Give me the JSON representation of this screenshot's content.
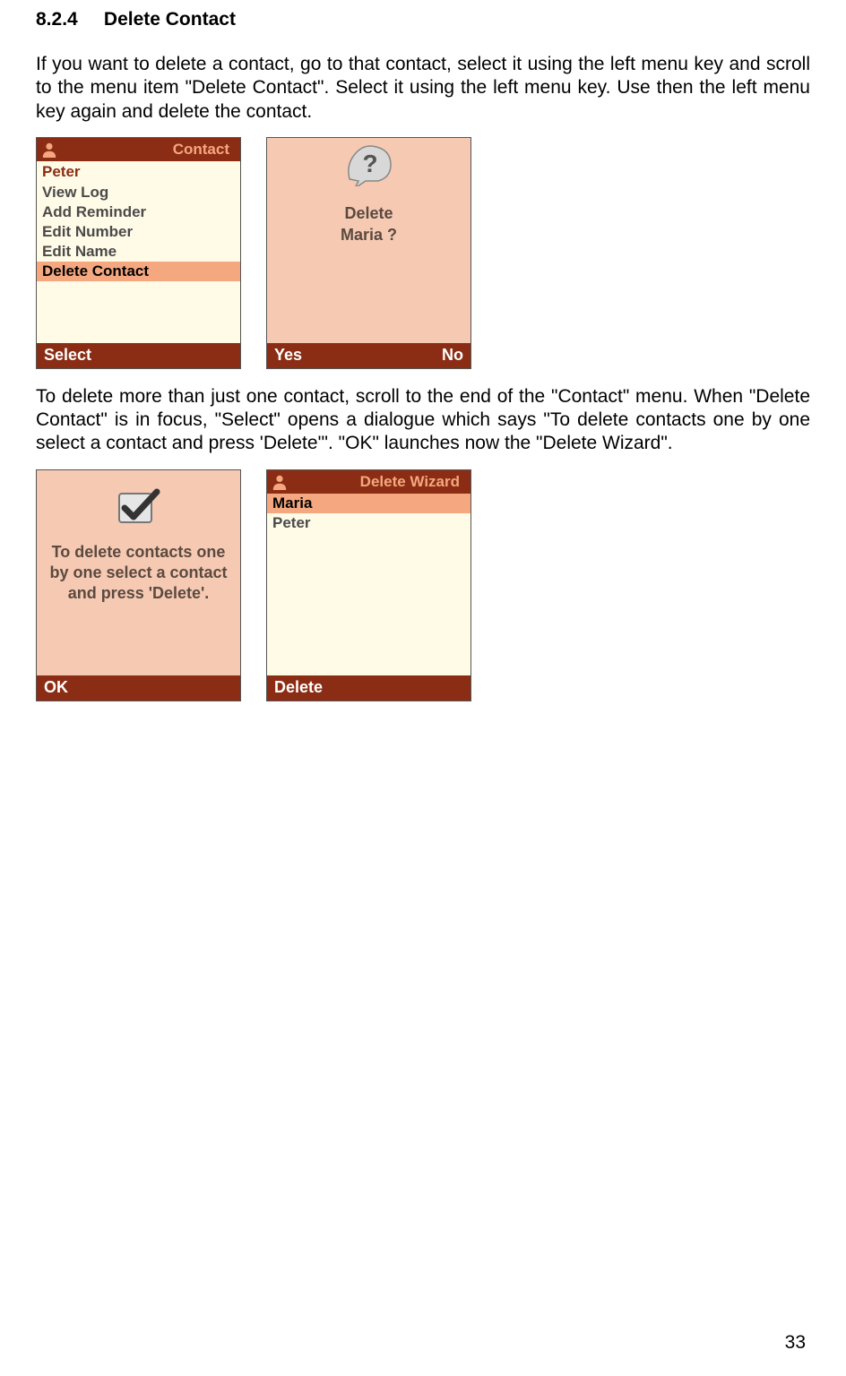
{
  "section": {
    "number": "8.2.4",
    "title": "Delete Contact"
  },
  "para1": "If you want to delete a contact, go to that contact, select it using the left menu key and scroll to the menu item \"Delete Contact\". Select it using the left menu key. Use then the left menu key again and delete the contact.",
  "para2": "To delete more than just one contact, scroll to the end of the \"Contact\" menu. When \"Delete Contact\" is in focus, \"Select\" opens a dialogue which says \"To delete contacts one by one select a contact and press 'Delete'\". \"OK\" launches now the \"Delete Wizard\".",
  "screen1": {
    "title": "Contact",
    "contact": "Peter",
    "items": [
      "View Log",
      "Add Reminder",
      "Edit Number",
      "Edit Name",
      "Delete Contact"
    ],
    "softLeft": "Select",
    "softRight": ""
  },
  "screen2": {
    "line1": "Delete",
    "line2": "Maria ?",
    "softLeft": "Yes",
    "softRight": "No"
  },
  "screen3": {
    "text": "To delete contacts one by one select a contact and press 'Delete'.",
    "softLeft": "OK",
    "softRight": ""
  },
  "screen4": {
    "title": "Delete Wizard",
    "selected": "Maria",
    "item": "Peter",
    "softLeft": "Delete",
    "softRight": ""
  },
  "pageNumber": "33"
}
